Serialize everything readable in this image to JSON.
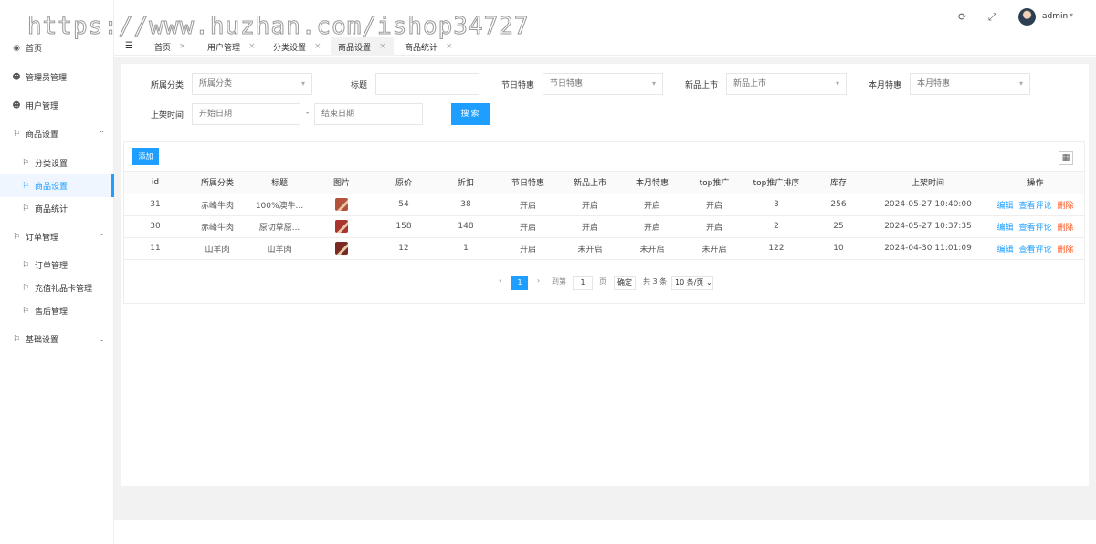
{
  "watermark": "https://www.huzhan.com/ishop34727",
  "sidebar": {
    "items": [
      {
        "label": "首页",
        "icon": "dashboard-icon"
      },
      {
        "label": "管理员管理",
        "icon": "users-icon"
      },
      {
        "label": "用户管理",
        "icon": "users-icon"
      },
      {
        "label": "商品设置",
        "icon": "flag-icon",
        "arrow": "^"
      },
      {
        "label": "分类设置",
        "icon": "flag-icon"
      },
      {
        "label": "商品设置",
        "icon": "flag-icon"
      },
      {
        "label": "商品统计",
        "icon": "flag-icon"
      },
      {
        "label": "订单管理",
        "icon": "flag-icon",
        "arrow": "^"
      },
      {
        "label": "订单管理",
        "icon": "flag-icon"
      },
      {
        "label": "充值礼品卡管理",
        "icon": "flag-icon"
      },
      {
        "label": "售后管理",
        "icon": "flag-icon"
      },
      {
        "label": "基础设置",
        "icon": "flag-icon",
        "arrow": "v"
      }
    ]
  },
  "header": {
    "user": "admin"
  },
  "tabs": [
    {
      "label": "首页"
    },
    {
      "label": "用户管理"
    },
    {
      "label": "分类设置"
    },
    {
      "label": "商品设置"
    },
    {
      "label": "商品统计"
    }
  ],
  "filters": {
    "category_label": "所属分类",
    "category_value": "所属分类",
    "title_label": "标题",
    "title_value": "",
    "festival_label": "节日特惠",
    "festival_value": "节日特惠",
    "new_label": "新品上市",
    "new_value": "新品上市",
    "month_label": "本月特惠",
    "month_value": "本月特惠",
    "time_label": "上架时间",
    "start_placeholder": "开始日期",
    "end_placeholder": "结束日期",
    "dash": "-",
    "search_button": "搜索"
  },
  "toolbar": {
    "add_button": "添加"
  },
  "table": {
    "headers": [
      "id",
      "所属分类",
      "标题",
      "图片",
      "原价",
      "折扣",
      "节日特惠",
      "新品上市",
      "本月特惠",
      "top推广",
      "top推广排序",
      "库存",
      "上架时间",
      "操作"
    ],
    "rows": [
      {
        "id": "31",
        "category": "赤峰牛肉",
        "title": "100%澳牛...",
        "price": "54",
        "discount": "38",
        "festival": "开启",
        "new": "开启",
        "month": "开启",
        "top": "开启",
        "top_sort": "3",
        "stock": "256",
        "time": "2024-05-27 10:40:00",
        "img_color": "#b5523b"
      },
      {
        "id": "30",
        "category": "赤峰牛肉",
        "title": "原切草原...",
        "price": "158",
        "discount": "148",
        "festival": "开启",
        "new": "开启",
        "month": "开启",
        "top": "开启",
        "top_sort": "2",
        "stock": "25",
        "time": "2024-05-27 10:37:35",
        "img_color": "#a8362f"
      },
      {
        "id": "11",
        "category": "山羊肉",
        "title": "山羊肉",
        "price": "12",
        "discount": "1",
        "festival": "开启",
        "new": "未开启",
        "month": "未开启",
        "top": "未开启",
        "top_sort": "122",
        "stock": "10",
        "time": "2024-04-30 11:01:09",
        "img_color": "#7a2a22"
      }
    ],
    "ops": {
      "edit": "编辑",
      "review": "查看评论",
      "delete": "删除"
    }
  },
  "pager": {
    "current": "1",
    "goto_label": "到第",
    "goto_value": "1",
    "page_unit": "页",
    "confirm": "确定",
    "total": "共 3 条",
    "page_size": "10 条/页"
  }
}
